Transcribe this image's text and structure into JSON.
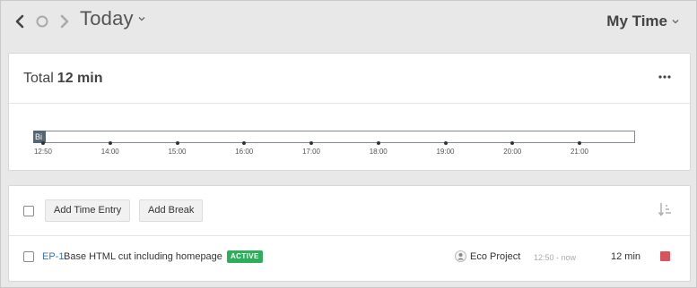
{
  "header": {
    "date_title": "Today",
    "view_title": "My Time"
  },
  "summary": {
    "total_label": "Total",
    "total_value": "12 min",
    "timeline": {
      "block_label": "Bi",
      "ticks": [
        "12:50",
        "14:00",
        "15:00",
        "16:00",
        "17:00",
        "18:00",
        "19:00",
        "20:00",
        "21:00"
      ]
    }
  },
  "toolbar": {
    "add_entry_label": "Add Time Entry",
    "add_break_label": "Add Break"
  },
  "entries": [
    {
      "key": "EP-1",
      "title": "Base HTML cut including homepage",
      "status": "ACTIVE",
      "project": "Eco Project",
      "time_range": "12:50 - now",
      "duration": "12 min"
    }
  ],
  "colors": {
    "active_badge": "#2eae5a",
    "stop_button": "#d9535c",
    "link": "#3572b0",
    "timeline_block": "#556573"
  },
  "icons": {
    "prev": "chevron-left-icon",
    "today": "circle-icon",
    "next": "chevron-right-icon",
    "more": "more-horizontal-icon",
    "sort": "sort-icon",
    "project": "project-avatar-icon",
    "stop": "stop-icon"
  }
}
